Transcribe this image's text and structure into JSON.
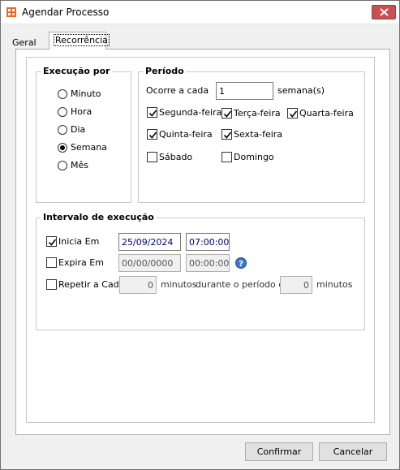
{
  "window": {
    "title": "Agendar Processo"
  },
  "tabs": [
    {
      "label": "Geral"
    },
    {
      "label": "Recorrência"
    }
  ],
  "execucao": {
    "label": "Execução por",
    "options": [
      {
        "label": "Minuto",
        "selected": false
      },
      {
        "label": "Hora",
        "selected": false
      },
      {
        "label": "Dia",
        "selected": false
      },
      {
        "label": "Semana",
        "selected": true
      },
      {
        "label": "Mês",
        "selected": false
      }
    ]
  },
  "periodo": {
    "label": "Período",
    "ocorre_label": "Ocorre a cada",
    "ocorre_value": "1",
    "unit_label": "semana(s)",
    "days": [
      {
        "label": "Segunda-feira",
        "checked": true
      },
      {
        "label": "Terça-feira",
        "checked": true
      },
      {
        "label": "Quarta-feira",
        "checked": true
      },
      {
        "label": "Quinta-feira",
        "checked": true
      },
      {
        "label": "Sexta-feira",
        "checked": true
      },
      {
        "label": "Sábado",
        "checked": false
      },
      {
        "label": "Domingo",
        "checked": false
      }
    ]
  },
  "intervalo": {
    "label": "Intervalo de execução",
    "inicia": {
      "label": "Inicia Em",
      "checked": true,
      "date": "25/09/2024",
      "time": "07:00:00"
    },
    "expira": {
      "label": "Expira Em",
      "checked": false,
      "date": "00/00/0000",
      "time": "00:00:00"
    },
    "repetir": {
      "label": "Repetir a Cada",
      "checked": false,
      "value": "0",
      "minutos1": "minutos",
      "durante": "durante o período de",
      "period_value": "0",
      "minutos2": "minutos"
    }
  },
  "buttons": {
    "confirmar": "Confirmar",
    "cancelar": "Cancelar"
  },
  "colors": {
    "close_button": "#c75050",
    "field_text": "#00007b",
    "info_icon": "#3b78c9"
  }
}
